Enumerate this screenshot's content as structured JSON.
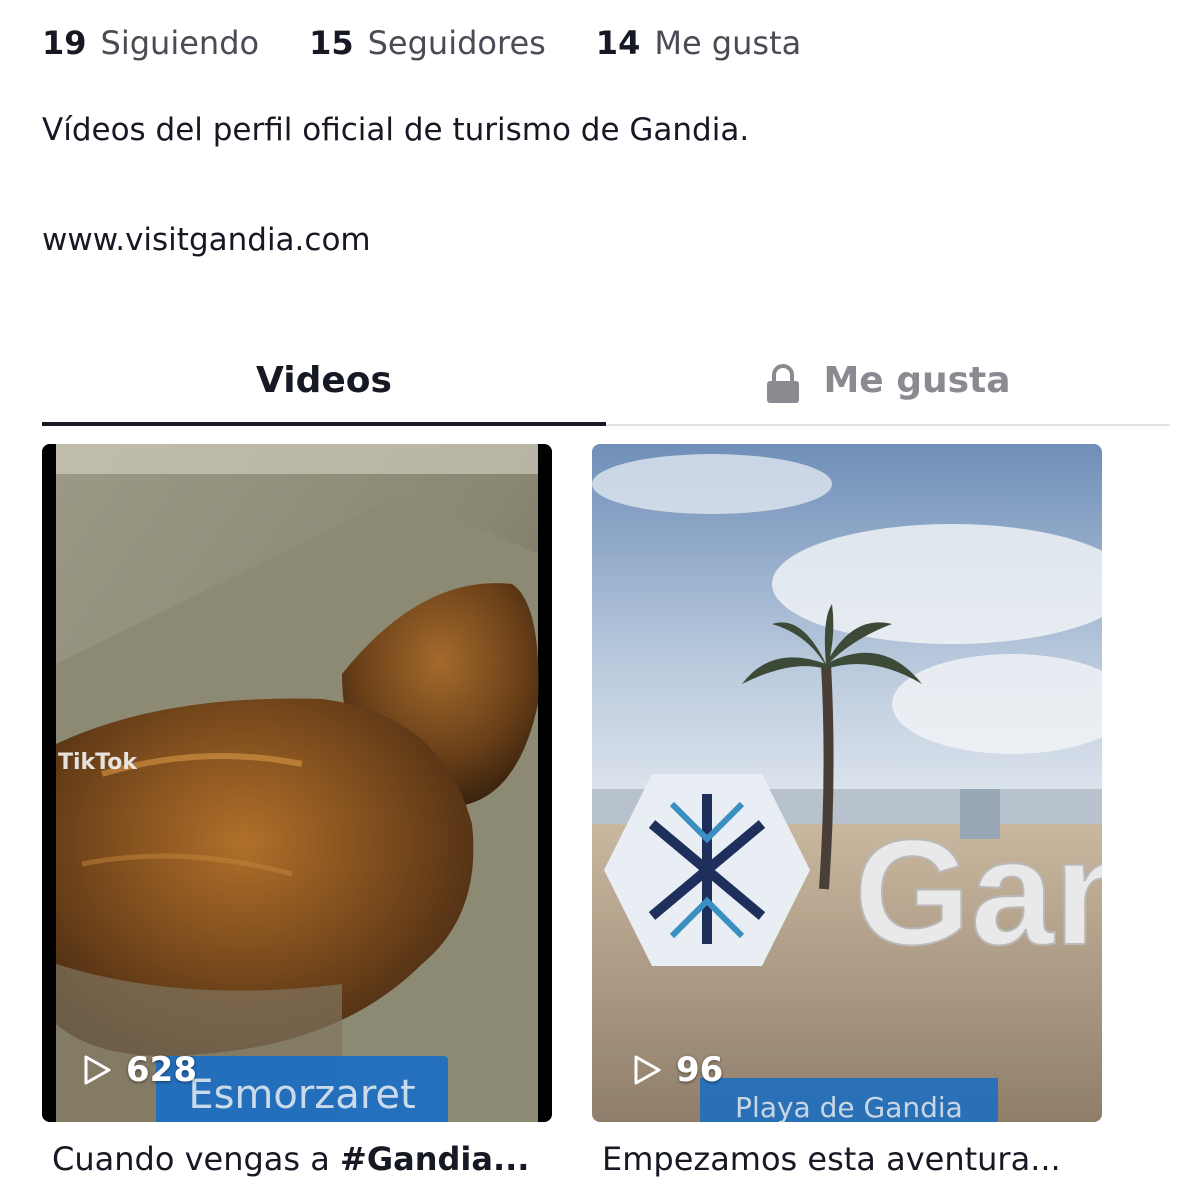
{
  "profile": {
    "stats": [
      {
        "count": "19",
        "label": "Siguiendo"
      },
      {
        "count": "15",
        "label": "Seguidores"
      },
      {
        "count": "14",
        "label": "Me gusta"
      }
    ],
    "bio": "Vídeos del perfil oficial de turismo de Gandia.",
    "link": "www.visitgandia.com"
  },
  "tabs": [
    {
      "label": "Videos",
      "active": true
    },
    {
      "label": "Me gusta",
      "active": false,
      "icon": "lock-icon"
    }
  ],
  "videos": [
    {
      "views": "628",
      "overlay_text": "Esmorzaret",
      "watermark": "TikTok",
      "caption_prefix": "Cuando vengas a ",
      "caption_bold": "#Gandia...",
      "icon": "play-icon"
    },
    {
      "views": "96",
      "overlay_text": "Playa de Gandia",
      "caption": "Empezamos esta aventura...",
      "icon": "play-icon"
    }
  ],
  "colors": {
    "text": "#161823",
    "muted": "#8a8b91",
    "overlay_blue": "#1f6fc0"
  }
}
